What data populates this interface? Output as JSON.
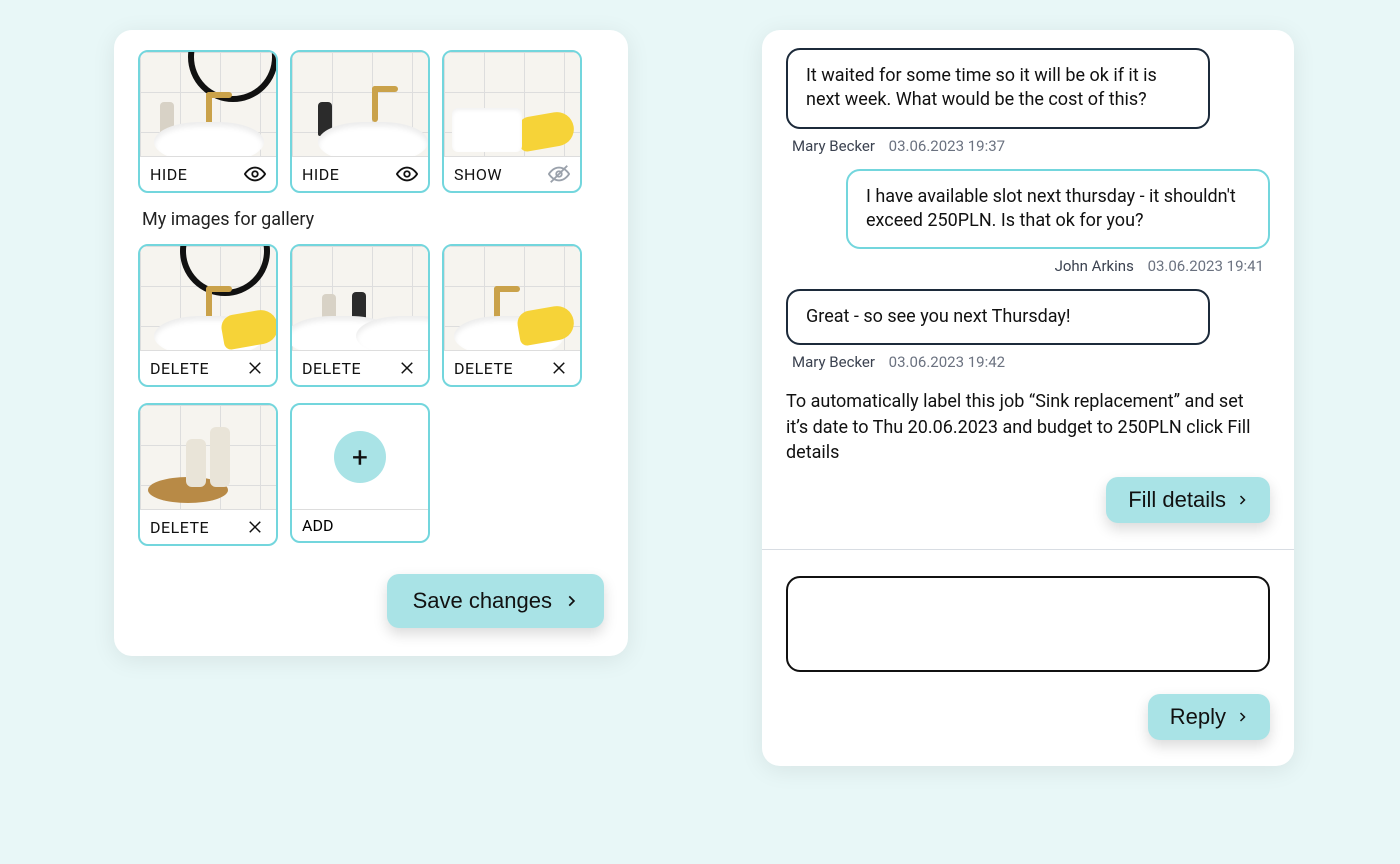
{
  "gallery": {
    "featured": [
      {
        "action_label": "HIDE",
        "state": "visible"
      },
      {
        "action_label": "HIDE",
        "state": "visible"
      },
      {
        "action_label": "SHOW",
        "state": "hidden"
      }
    ],
    "my_images_label": "My images for gallery",
    "mine": [
      {
        "action_label": "DELETE"
      },
      {
        "action_label": "DELETE"
      },
      {
        "action_label": "DELETE"
      },
      {
        "action_label": "DELETE"
      }
    ],
    "add_label": "ADD",
    "save_label": "Save changes"
  },
  "chat": {
    "messages": [
      {
        "side": "left",
        "text": "It waited for some time so it will be ok if it is next week. What would be the cost of this?",
        "author": "Mary Becker",
        "timestamp": "03.06.2023 19:37"
      },
      {
        "side": "right",
        "text": "I have available slot next thursday - it shouldn't exceed 250PLN. Is that ok for you?",
        "author": "John Arkins",
        "timestamp": "03.06.2023 19:41"
      },
      {
        "side": "left",
        "text": "Great - so see you next Thursday!",
        "author": "Mary Becker",
        "timestamp": "03.06.2023 19:42"
      }
    ],
    "auto_note": "To automatically label this job “Sink replacement” and set it’s date to Thu 20.06.2023 and budget to 250PLN click Fill details",
    "fill_label": "Fill details",
    "reply_label": "Reply",
    "compose_value": ""
  }
}
